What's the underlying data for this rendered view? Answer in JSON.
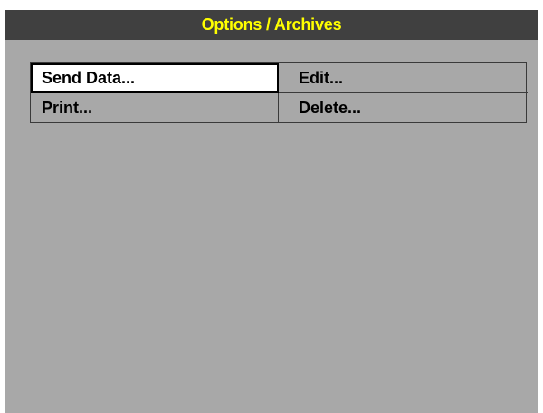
{
  "window": {
    "title": "Options / Archives"
  },
  "menu": {
    "items": [
      {
        "label": "Send Data...",
        "selected": true
      },
      {
        "label": "Edit...",
        "selected": false
      },
      {
        "label": "Print...",
        "selected": false
      },
      {
        "label": "Delete...",
        "selected": false
      }
    ]
  },
  "colors": {
    "title_bar": "#404040",
    "title_text": "#ffff00",
    "background": "#a8a8a8",
    "selected_item": "#ffffff"
  }
}
